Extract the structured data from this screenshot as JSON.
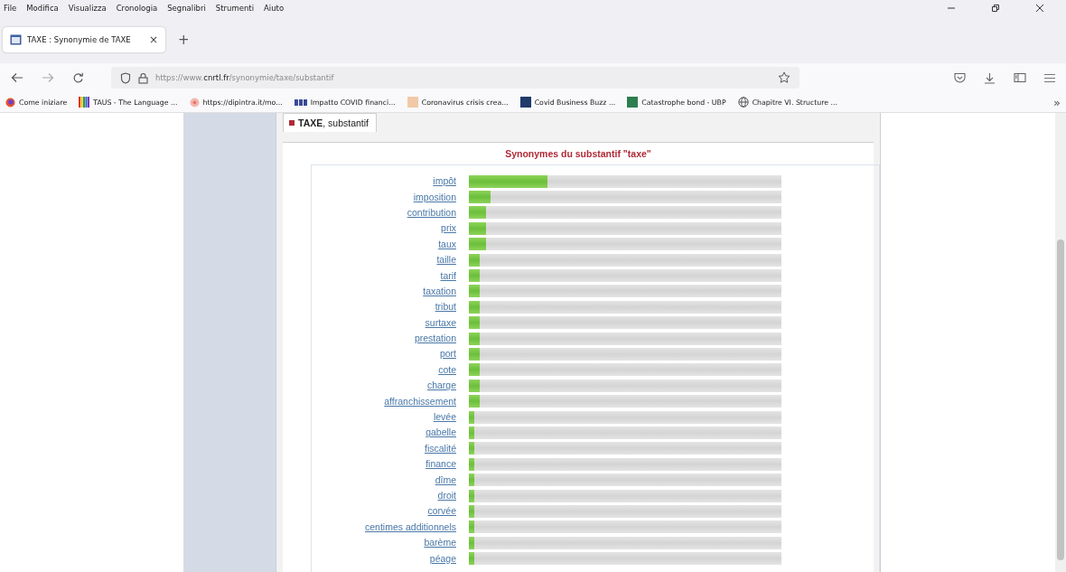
{
  "menu": [
    "File",
    "Modifica",
    "Visualizza",
    "Cronologia",
    "Segnalibri",
    "Strumenti",
    "Aiuto"
  ],
  "tab": {
    "title": "TAXE : Synonymie de TAXE",
    "close": "×"
  },
  "new_tab": "+",
  "address": {
    "host_prefix": "https://www.",
    "host": "cnrtl.fr",
    "path": "/synonymie/taxe/substantif"
  },
  "bookmarks": [
    {
      "kind": "firefox",
      "label": "Come iniziare"
    },
    {
      "kind": "stripes",
      "label": "TAUS - The Language ..."
    },
    {
      "kind": "circle",
      "label": "https://dipintra.it/mo..."
    },
    {
      "kind": "bars",
      "label": "Impatto COVID financi..."
    },
    {
      "kind": "square",
      "color": "#f2c9a8",
      "label": "Coronavirus crisis crea..."
    },
    {
      "kind": "square",
      "color": "#1f3a6b",
      "label": "Covid Business Buzz ..."
    },
    {
      "kind": "square",
      "color": "#2e7d4f",
      "label": "Catastrophe bond - UBP"
    },
    {
      "kind": "globe",
      "label": "Chapitre VI. Structure ..."
    }
  ],
  "overflow": "»",
  "page": {
    "tab_label": "**TAXE**, substantif",
    "title": "Synonymes du substantif \"taxe\"",
    "synonyms": [
      {
        "word": "impôt",
        "level": 0.25
      },
      {
        "word": "imposition",
        "level": 0.07
      },
      {
        "word": "contribution",
        "level": 0.055
      },
      {
        "word": "prix",
        "level": 0.055
      },
      {
        "word": "taux",
        "level": 0.055
      },
      {
        "word": "taille",
        "level": 0.035
      },
      {
        "word": "tarif",
        "level": 0.035
      },
      {
        "word": "taxation",
        "level": 0.035
      },
      {
        "word": "tribut",
        "level": 0.035
      },
      {
        "word": "surtaxe",
        "level": 0.035
      },
      {
        "word": "prestation",
        "level": 0.035
      },
      {
        "word": "port",
        "level": 0.035
      },
      {
        "word": "cote",
        "level": 0.035
      },
      {
        "word": "charge",
        "level": 0.035
      },
      {
        "word": "affranchissement",
        "level": 0.035
      },
      {
        "word": "levée",
        "level": 0.018
      },
      {
        "word": "gabelle",
        "level": 0.018
      },
      {
        "word": "fiscalité",
        "level": 0.018
      },
      {
        "word": "finance",
        "level": 0.018
      },
      {
        "word": "dîme",
        "level": 0.018
      },
      {
        "word": "droit",
        "level": 0.018
      },
      {
        "word": "corvée",
        "level": 0.018
      },
      {
        "word": "centimes additionnels",
        "level": 0.018
      },
      {
        "word": "barème",
        "level": 0.018
      },
      {
        "word": "péage",
        "level": 0.018
      }
    ]
  }
}
